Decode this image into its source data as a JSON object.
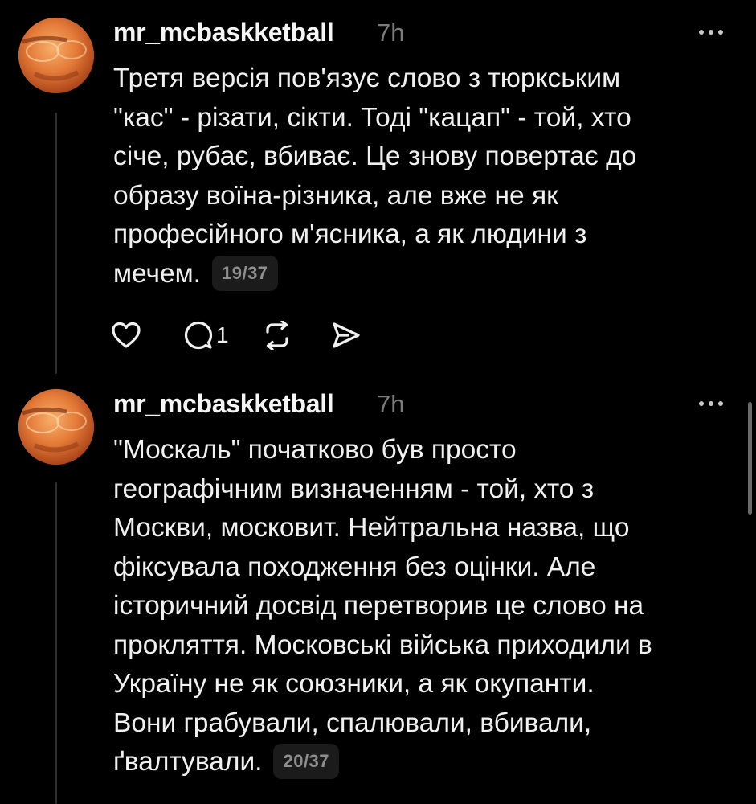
{
  "posts": [
    {
      "username": "mr_mcbaskketball",
      "time": "7h",
      "lines": [
        "Третя версія пов'язує слово з тюркським",
        "\"кас\" - різати, сікти. Тоді \"кацап\" - той, хто",
        "січе, рубає, вбиває. Це знову повертає до",
        "образу воїна-різника, але вже не як",
        "професійного м'ясника, а як людини з",
        "мечем."
      ],
      "counter": "19/37",
      "actions": {
        "like_icon": "heart-icon",
        "reply_icon": "comment-icon",
        "reply_count": "1",
        "repost_icon": "repost-icon",
        "share_icon": "send-icon"
      }
    },
    {
      "username": "mr_mcbaskketball",
      "time": "7h",
      "lines": [
        "\"Москаль\" початково був просто",
        "географічним визначенням - той, хто з",
        "Москви, московит. Нейтральна назва, що",
        "фіксувала походження без оцінки. Але",
        "історичний досвід перетворив це слово на",
        "прокляття. Московські війська приходили в",
        "Україну не як союзники, а як окупанти.",
        "Вони грабували, спалювали, вбивали,",
        "ґвалтували."
      ],
      "counter": "20/37"
    }
  ],
  "colors": {
    "background": "#000000",
    "text": "#f0f0f0",
    "muted": "#7c7c7c",
    "counter_bg": "#1b1b1b"
  }
}
